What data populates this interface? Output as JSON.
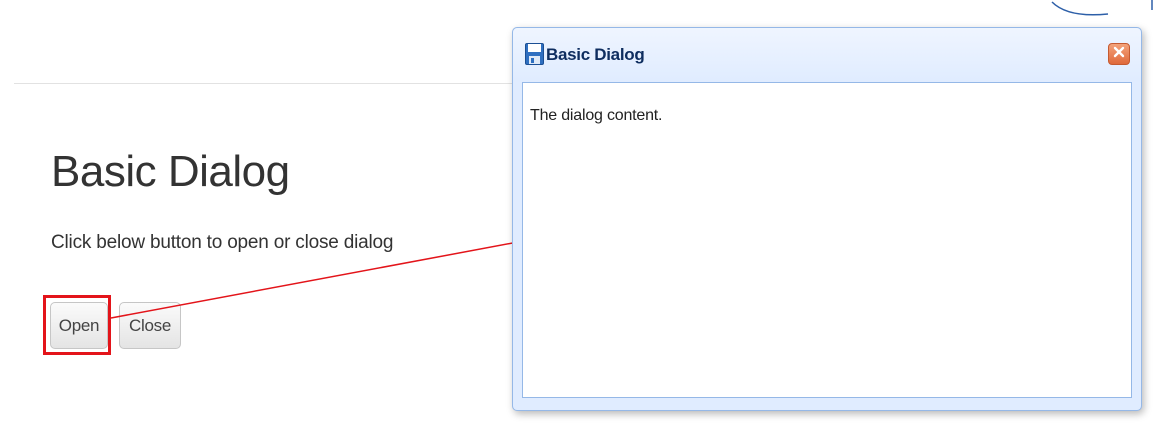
{
  "page": {
    "title": "Basic Dialog",
    "description": "Click below button to open or close dialog"
  },
  "buttons": {
    "open_label": "Open",
    "close_label": "Close"
  },
  "dialog": {
    "title": "Basic Dialog",
    "content": "The dialog content.",
    "icon": "save-icon",
    "close_icon": "close-icon"
  },
  "annotation": {
    "highlight_color": "#e3141a",
    "arrow_color": "#e3141a"
  },
  "colors": {
    "dialog_border": "#95b8e7",
    "dialog_header_bg": "#e0ecff",
    "close_button_bg": "#e0693b"
  }
}
